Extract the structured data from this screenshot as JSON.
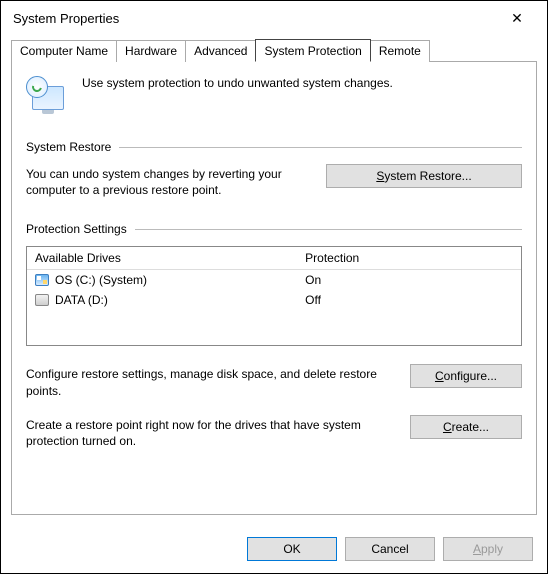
{
  "window": {
    "title": "System Properties",
    "close": "✕"
  },
  "tabs": {
    "computer_name": "Computer Name",
    "hardware": "Hardware",
    "advanced": "Advanced",
    "system_protection": "System Protection",
    "remote": "Remote"
  },
  "intro": "Use system protection to undo unwanted system changes.",
  "restore": {
    "heading": "System Restore",
    "desc": "You can undo system changes by reverting your computer to a previous restore point.",
    "button": "System Restore..."
  },
  "settings": {
    "heading": "Protection Settings",
    "col_drives": "Available Drives",
    "col_protection": "Protection",
    "drives": [
      {
        "label": "OS (C:) (System)",
        "protection": "On",
        "icon": "os"
      },
      {
        "label": "DATA (D:)",
        "protection": "Off",
        "icon": "hd"
      }
    ],
    "configure_desc": "Configure restore settings, manage disk space, and delete restore points.",
    "configure_btn": "Configure...",
    "create_desc": "Create a restore point right now for the drives that have system protection turned on.",
    "create_btn": "Create..."
  },
  "footer": {
    "ok": "OK",
    "cancel": "Cancel",
    "apply": "Apply"
  }
}
